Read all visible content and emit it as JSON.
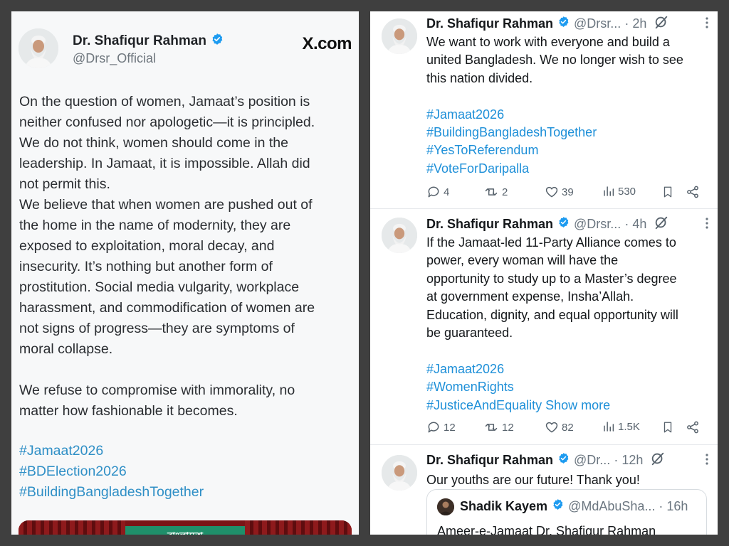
{
  "left_post": {
    "author_name": "Dr. Shafiqur Rahman",
    "author_handle": "@Drsr_Official",
    "site_mark": "X.com",
    "paragraph_1": "On the question of women, Jamaat’s position is\nneither confused nor apologetic—it is principled.\nWe do not think, women should come in the\nleadership. In Jamaat, it is impossible. Allah did\nnot permit this.\nWe believe that when women are pushed out of\nthe home in the name of modernity, they are\nexposed to exploitation, moral decay, and\ninsecurity. It’s nothing but another form of\nprostitution. Social media vulgarity, workplace\nharassment, and commodification of women are\nnot signs of progress—they are symptoms of\nmoral collapse.",
    "paragraph_2": "We refuse to compromise with immorality, no\nmatter how fashionable it becomes.",
    "hashtags": [
      "#Jamaat2026",
      "#BDElection2026",
      "#BuildingBangladeshTogether"
    ],
    "image_banner_text": "বাংলাদেশ"
  },
  "colors": {
    "verified_badge": "#1d9bf0",
    "hashtag_left": "#2f8fc6",
    "hashtag_right": "#1d8fd8",
    "panel_background": "#3f3f3f"
  },
  "timeline": {
    "tweets": [
      {
        "author_name": "Dr. Shafiqur Rahman",
        "handle": "@Drsr...",
        "separator": "·",
        "time": "2h",
        "more_icon": "vertical-ellipsis",
        "text": "We want to work with everyone and build a\nunited Bangladesh. We no longer wish to see\nthis nation divided.",
        "hashtags": [
          "#Jamaat2026",
          "#BuildingBangladeshTogether",
          "#YesToReferendum",
          "#VoteForDaripalla"
        ],
        "show_more": "",
        "stats": {
          "replies": "4",
          "reposts": "2",
          "likes": "39",
          "views": "530"
        }
      },
      {
        "author_name": "Dr. Shafiqur Rahman",
        "handle": "@Drsr...",
        "separator": "·",
        "time": "4h",
        "more_icon": "vertical-ellipsis",
        "text": "If the Jamaat-led 11-Party Alliance comes to\npower, every woman will have the\nopportunity to study up to a Master’s degree\nat government expense, Insha’Allah.\nEducation, dignity, and equal opportunity will\nbe guaranteed.",
        "hashtags": [
          "#Jamaat2026",
          "#WomenRights",
          "#JusticeAndEquality"
        ],
        "show_more": "Show more",
        "stats": {
          "replies": "12",
          "reposts": "12",
          "likes": "82",
          "views": "1.5K"
        }
      },
      {
        "author_name": "Dr. Shafiqur Rahman",
        "handle": "@Dr...",
        "separator": "·",
        "time": "12h",
        "more_icon": "vertical-ellipsis",
        "text": "Our youths are our future! Thank you!",
        "quote": {
          "author_name": "Shadik Kayem",
          "handle": "@MdAbuSha...",
          "separator": "·",
          "time": "16h",
          "text": "Ameer-e-Jamaat Dr. Shafiqur Rahman"
        }
      }
    ]
  }
}
